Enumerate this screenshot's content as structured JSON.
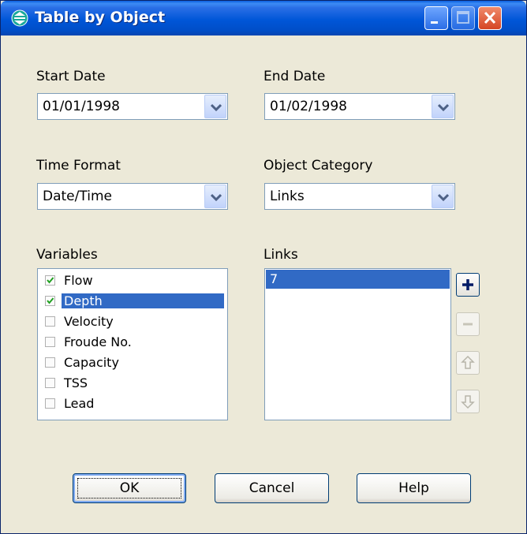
{
  "window": {
    "title": "Table by Object"
  },
  "start_date": {
    "label": "Start Date",
    "value": "01/01/1998"
  },
  "end_date": {
    "label": "End Date",
    "value": "01/02/1998"
  },
  "time_format": {
    "label": "Time Format",
    "value": "Date/Time"
  },
  "object_category": {
    "label": "Object Category",
    "value": "Links"
  },
  "variables": {
    "label": "Variables",
    "items": [
      {
        "label": "Flow",
        "checked": true,
        "selected": false
      },
      {
        "label": "Depth",
        "checked": true,
        "selected": true
      },
      {
        "label": "Velocity",
        "checked": false,
        "selected": false
      },
      {
        "label": "Froude No.",
        "checked": false,
        "selected": false
      },
      {
        "label": "Capacity",
        "checked": false,
        "selected": false
      },
      {
        "label": "TSS",
        "checked": false,
        "selected": false
      },
      {
        "label": "Lead",
        "checked": false,
        "selected": false
      }
    ]
  },
  "links": {
    "label": "Links",
    "items": [
      "7"
    ]
  },
  "buttons": {
    "ok": "OK",
    "cancel": "Cancel",
    "help": "Help"
  },
  "colors": {
    "selection": "#316ac5",
    "titlebar": "#0054e3",
    "dialog_bg": "#ece9d8"
  }
}
